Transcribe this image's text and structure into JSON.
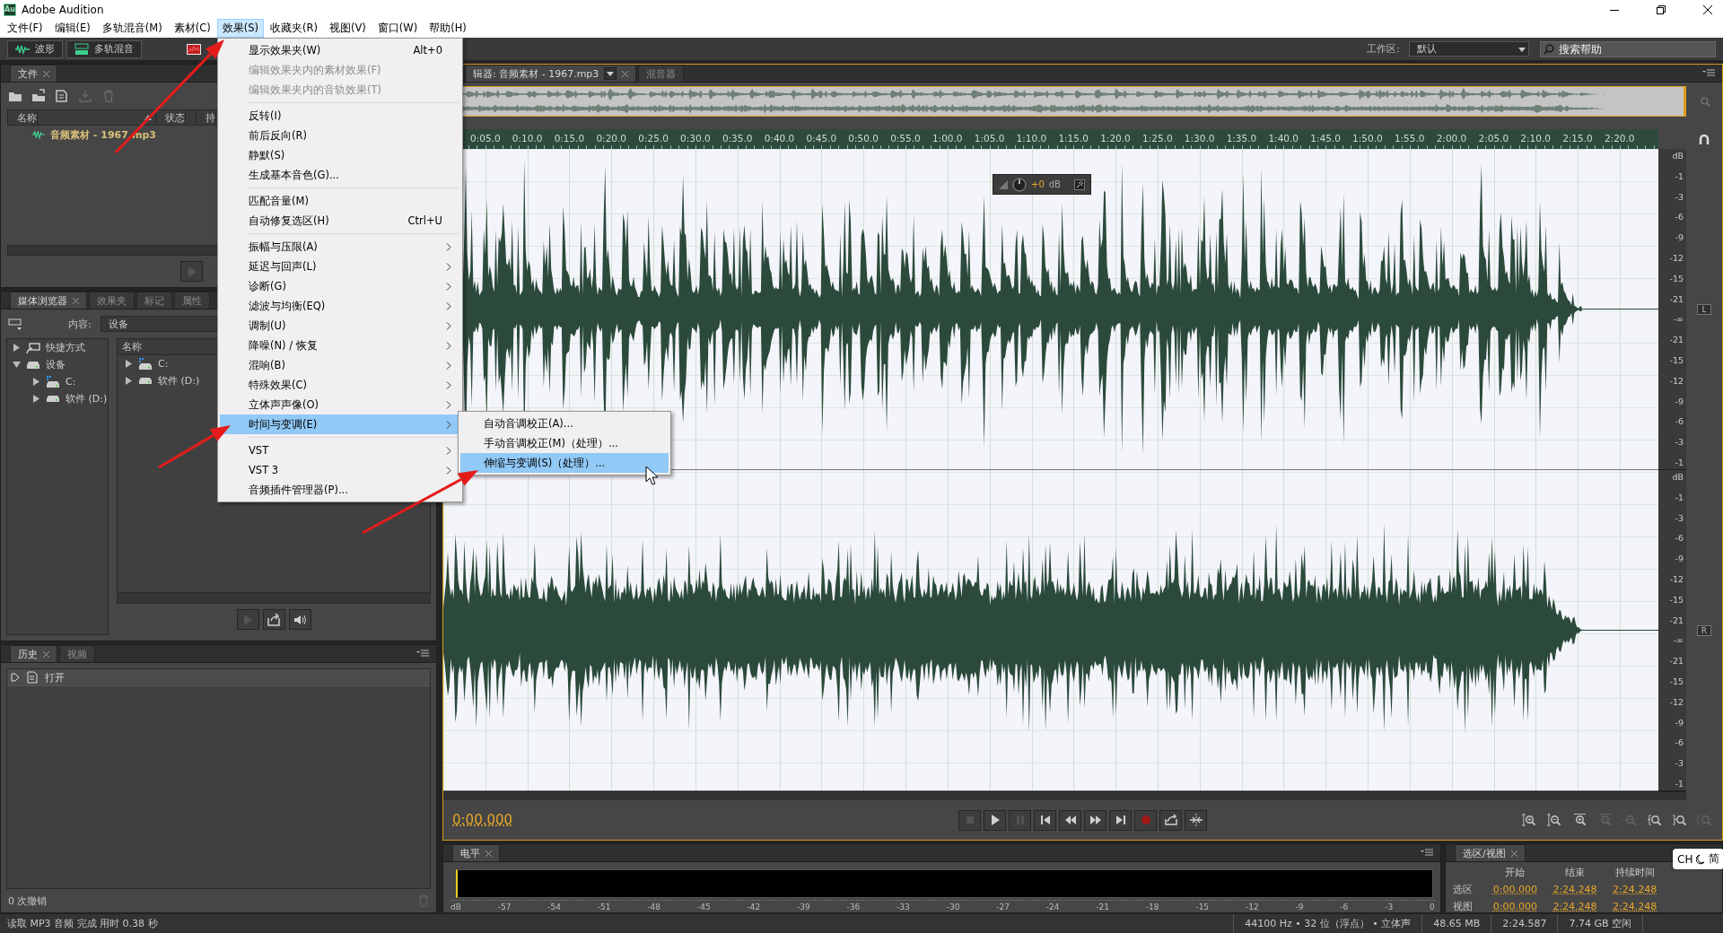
{
  "window": {
    "logo_text": "Au",
    "title": "Adobe Audition"
  },
  "menu_bar": [
    {
      "label": "文件(F)",
      "selected": false
    },
    {
      "label": "编辑(E)",
      "selected": false
    },
    {
      "label": "多轨混音(M)",
      "selected": false
    },
    {
      "label": "素材(C)",
      "selected": false
    },
    {
      "label": "效果(S)",
      "selected": true
    },
    {
      "label": "收藏夹(R)",
      "selected": false
    },
    {
      "label": "视图(V)",
      "selected": false
    },
    {
      "label": "窗口(W)",
      "selected": false
    },
    {
      "label": "帮助(H)",
      "selected": false
    }
  ],
  "toolbar": {
    "view_buttons": [
      {
        "kind": "waveform",
        "label": "波形"
      },
      {
        "kind": "multitrack",
        "label": "多轨混音"
      }
    ],
    "workspace_label": "工作区:",
    "workspace": "默认",
    "search_placeholder": "搜索帮助"
  },
  "files_panel": {
    "tabs": [
      {
        "label": "文件",
        "selected": true
      }
    ],
    "tools": [
      {
        "kind": "open",
        "disabled": false
      },
      {
        "kind": "import",
        "disabled": false
      },
      {
        "kind": "new",
        "disabled": false
      },
      {
        "kind": "insert",
        "disabled": true
      },
      {
        "kind": "delete",
        "disabled": true
      }
    ],
    "columns": [
      "名称",
      "状态",
      "持"
    ],
    "files": [
      "音频素材 - 1967.mp3"
    ],
    "footer_buttons": [
      {
        "kind": "play",
        "disabled": true
      }
    ]
  },
  "media_browser": {
    "tabs": [
      {
        "label": "媒体浏览器",
        "selected": true
      },
      {
        "label": "效果夹",
        "selected": false
      },
      {
        "label": "标记",
        "selected": false
      },
      {
        "label": "属性",
        "selected": false
      }
    ],
    "content_label": "内容:",
    "content_value": "设备",
    "tree": [
      {
        "kind": "shortcut",
        "label": "快捷方式",
        "expanded": false
      },
      {
        "kind": "devices",
        "label": "设备",
        "expanded": true,
        "children": [
          {
            "kind": "system_drive",
            "label": "C:",
            "expanded": false
          },
          {
            "kind": "drive",
            "label": "软件 (D:)",
            "expanded": false
          }
        ]
      }
    ],
    "list_header": "名称",
    "list": [
      {
        "kind": "system_drive",
        "label": "C:",
        "expanded": false
      },
      {
        "kind": "drive",
        "label": "软件 (D:)",
        "expanded": false
      }
    ],
    "preview_buttons": [
      {
        "kind": "play",
        "disabled": true
      },
      {
        "kind": "export",
        "disabled": false
      },
      {
        "kind": "autoplay",
        "disabled": false
      }
    ]
  },
  "history": {
    "tabs": [
      {
        "label": "历史",
        "selected": true
      },
      {
        "label": "视频",
        "selected": false
      }
    ],
    "items": [
      "打开"
    ],
    "undo_count": "0 次撤销"
  },
  "editor": {
    "tabs": [
      {
        "label": "辑器: 音频素材 - 1967.mp3",
        "selected": true,
        "dropdown": true
      },
      {
        "label": "混音器",
        "selected": false,
        "dropdown": false
      }
    ],
    "ruler": [
      "0:05.0",
      "0:10.0",
      "0:15.0",
      "0:20.0",
      "0:25.0",
      "0:30.0",
      "0:35.0",
      "0:40.0",
      "0:45.0",
      "0:50.0",
      "0:55.0",
      "1:00.0",
      "1:05.0",
      "1:10.0",
      "1:15.0",
      "1:20.0",
      "1:25.0",
      "1:30.0",
      "1:35.0",
      "1:40.0",
      "1:45.0",
      "1:50.0",
      "1:55.0",
      "2:00.0",
      "2:05.0",
      "2:10.0",
      "2:15.0",
      "2:20.0"
    ],
    "hud": {
      "gain": "+0",
      "unit": "dB"
    },
    "channels": [
      {
        "label": "L",
        "unit": "dB",
        "kind": "beats",
        "scale": [
          "-1",
          "-3",
          "-6",
          "-9",
          "-12",
          "-15",
          "-21",
          "-∞",
          "-21",
          "-15",
          "-12",
          "-9",
          "-6",
          "-3",
          "-1"
        ]
      },
      {
        "label": "R",
        "unit": "dB",
        "kind": "dense",
        "scale": [
          "-1",
          "-3",
          "-6",
          "-9",
          "-12",
          "-15",
          "-21",
          "-∞",
          "-21",
          "-15",
          "-12",
          "-9",
          "-6",
          "-3",
          "-1"
        ]
      }
    ],
    "time": "0:00.000",
    "transport": [
      {
        "kind": "stop",
        "disabled": true
      },
      {
        "kind": "play",
        "disabled": false
      },
      {
        "kind": "pause",
        "disabled": true
      },
      {
        "kind": "to_start",
        "disabled": false
      },
      {
        "kind": "rewind",
        "disabled": false
      },
      {
        "kind": "fast_forward",
        "disabled": false
      },
      {
        "kind": "to_end",
        "disabled": false
      },
      {
        "kind": "record",
        "disabled": false
      },
      {
        "kind": "loop",
        "disabled": false
      },
      {
        "kind": "skip_selection",
        "disabled": false
      }
    ],
    "zoom_tools": [
      {
        "kind": "zoom_in_amplitude",
        "disabled": false
      },
      {
        "kind": "zoom_out_amplitude",
        "disabled": false
      },
      {
        "kind": "zoom_in_time",
        "disabled": false
      },
      {
        "kind": "zoom_out_time",
        "disabled": true
      },
      {
        "kind": "zoom_out_full",
        "disabled": true
      },
      {
        "kind": "zoom_in_start",
        "disabled": false
      },
      {
        "kind": "zoom_in_end",
        "disabled": false
      },
      {
        "kind": "zoom_selection",
        "disabled": true
      }
    ]
  },
  "level_panel": {
    "tabs": [
      {
        "label": "电平",
        "selected": true
      }
    ],
    "scale": [
      "dB",
      "-57",
      "-54",
      "-51",
      "-48",
      "-45",
      "-42",
      "-39",
      "-36",
      "-33",
      "-30",
      "-27",
      "-24",
      "-21",
      "-18",
      "-15",
      "-12",
      "-9",
      "-6",
      "-3",
      "0"
    ]
  },
  "selection_panel": {
    "tabs": [
      {
        "label": "选区/视图",
        "selected": true
      }
    ],
    "headers": [
      "开始",
      "结束",
      "持续时间"
    ],
    "rows": [
      {
        "label": "选区",
        "values": [
          "0:00.000",
          "2:24.248",
          "2:24.248"
        ]
      },
      {
        "label": "视图",
        "values": [
          "0:00.000",
          "2:24.248",
          "2:24.248"
        ]
      }
    ]
  },
  "status_bar": {
    "message": "读取 MP3 音频 完成 用时 0.38 秒",
    "format": "44100 Hz • 32 位（浮点） • 立体声",
    "size": "48.65 MB",
    "duration": "2:24.587",
    "free": "7.74 GB 空闲"
  },
  "effects_menu": {
    "items": [
      {
        "kind": "item",
        "label": "显示效果夹(W)",
        "shortcut": "Alt+0",
        "disabled": false,
        "submenu": false,
        "selected": false
      },
      {
        "kind": "item",
        "label": "编辑效果夹内的素材效果(F)",
        "disabled": true,
        "submenu": false,
        "selected": false
      },
      {
        "kind": "item",
        "label": "编辑效果夹内的音轨效果(T)",
        "disabled": true,
        "submenu": false,
        "selected": false
      },
      {
        "kind": "separator"
      },
      {
        "kind": "item",
        "label": "反转(I)",
        "disabled": false,
        "submenu": false,
        "selected": false
      },
      {
        "kind": "item",
        "label": "前后反向(R)",
        "disabled": false,
        "submenu": false,
        "selected": false
      },
      {
        "kind": "item",
        "label": "静默(S)",
        "disabled": false,
        "submenu": false,
        "selected": false
      },
      {
        "kind": "item",
        "label": "生成基本音色(G)...",
        "disabled": false,
        "submenu": false,
        "selected": false
      },
      {
        "kind": "separator"
      },
      {
        "kind": "item",
        "label": "匹配音量(M)",
        "disabled": false,
        "submenu": false,
        "selected": false
      },
      {
        "kind": "item",
        "label": "自动修复选区(H)",
        "shortcut": "Ctrl+U",
        "disabled": false,
        "submenu": false,
        "selected": false
      },
      {
        "kind": "separator"
      },
      {
        "kind": "item",
        "label": "振幅与压限(A)",
        "disabled": false,
        "submenu": true,
        "selected": false
      },
      {
        "kind": "item",
        "label": "延迟与回声(L)",
        "disabled": false,
        "submenu": true,
        "selected": false
      },
      {
        "kind": "item",
        "label": "诊断(G)",
        "disabled": false,
        "submenu": true,
        "selected": false
      },
      {
        "kind": "item",
        "label": "滤波与均衡(EQ)",
        "disabled": false,
        "submenu": true,
        "selected": false
      },
      {
        "kind": "item",
        "label": "调制(U)",
        "disabled": false,
        "submenu": true,
        "selected": false
      },
      {
        "kind": "item",
        "label": "降噪(N) / 恢复",
        "disabled": false,
        "submenu": true,
        "selected": false
      },
      {
        "kind": "item",
        "label": "混响(B)",
        "disabled": false,
        "submenu": true,
        "selected": false
      },
      {
        "kind": "item",
        "label": "特殊效果(C)",
        "disabled": false,
        "submenu": true,
        "selected": false
      },
      {
        "kind": "item",
        "label": "立体声声像(O)",
        "disabled": false,
        "submenu": true,
        "selected": false
      },
      {
        "kind": "item",
        "label": "时间与变调(E)",
        "disabled": false,
        "submenu": true,
        "selected": true
      },
      {
        "kind": "separator"
      },
      {
        "kind": "item",
        "label": "VST",
        "disabled": false,
        "submenu": true,
        "selected": false
      },
      {
        "kind": "item",
        "label": "VST 3",
        "disabled": false,
        "submenu": true,
        "selected": false
      },
      {
        "kind": "item",
        "label": "音频插件管理器(P)...",
        "disabled": false,
        "submenu": false,
        "selected": false
      }
    ],
    "submenu": [
      {
        "label": "自动音调校正(A)...",
        "selected": false
      },
      {
        "label": "手动音调校正(M)（处理）...",
        "selected": false
      },
      {
        "label": "伸缩与变调(S)（处理）...",
        "selected": true
      }
    ]
  },
  "ime": {
    "language": "CH",
    "mode": "简"
  }
}
